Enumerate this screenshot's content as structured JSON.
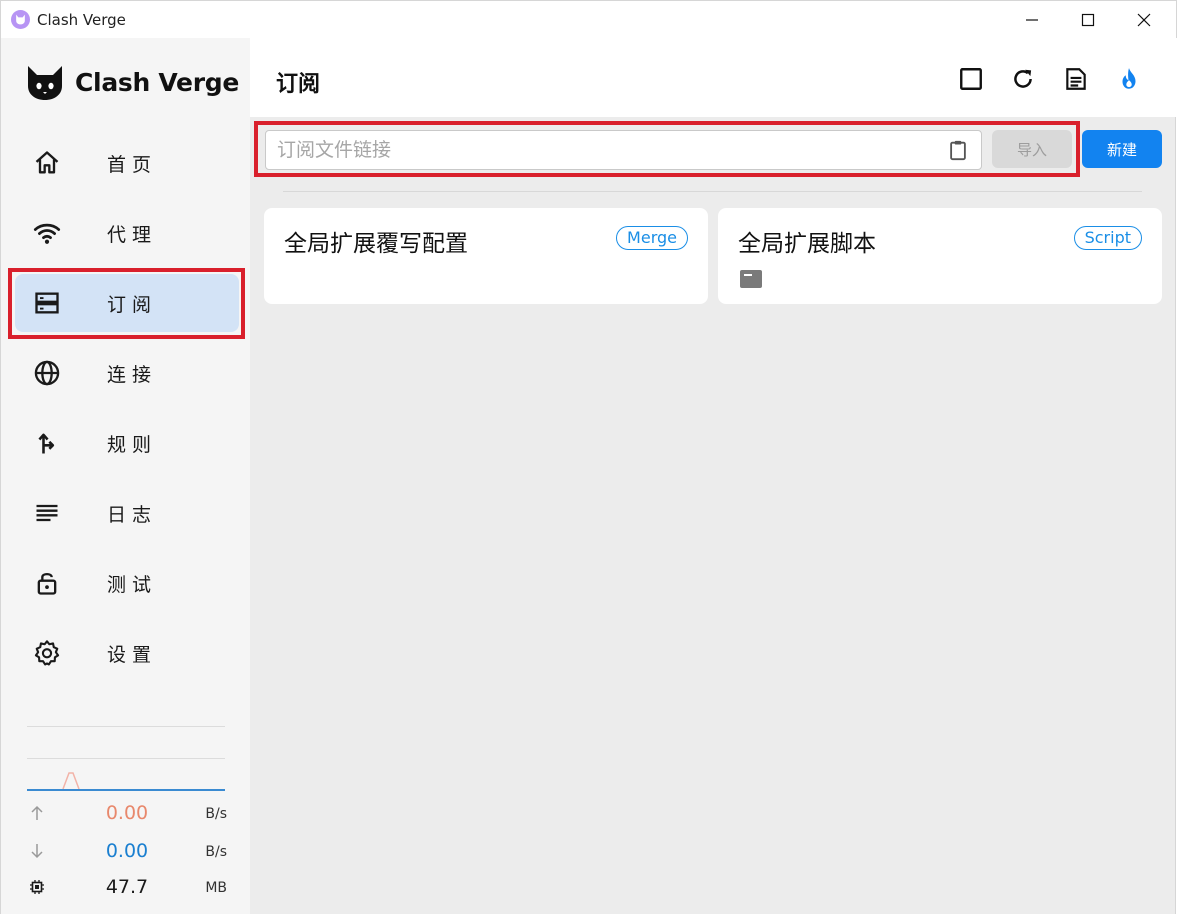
{
  "window": {
    "title": "Clash Verge"
  },
  "sidebar": {
    "logo_text": "Clash Verge",
    "items": [
      {
        "label": "首页",
        "icon": "home-icon",
        "active": false
      },
      {
        "label": "代理",
        "icon": "wifi-icon",
        "active": false
      },
      {
        "label": "订阅",
        "icon": "storage-icon",
        "active": true
      },
      {
        "label": "连接",
        "icon": "globe-icon",
        "active": false
      },
      {
        "label": "规则",
        "icon": "fork-arrow-icon",
        "active": false
      },
      {
        "label": "日志",
        "icon": "lines-icon",
        "active": false
      },
      {
        "label": "测试",
        "icon": "lock-open-icon",
        "active": false
      },
      {
        "label": "设置",
        "icon": "gear-icon",
        "active": false
      }
    ],
    "traffic": {
      "upload": {
        "value": "0.00",
        "unit": "B/s",
        "color": "#e8886c"
      },
      "download": {
        "value": "0.00",
        "unit": "B/s",
        "color": "#1a7fd0"
      },
      "memory": {
        "value": "47.7",
        "unit": "MB",
        "color": "#1a1a1a"
      }
    }
  },
  "main": {
    "title": "订阅",
    "url_input": {
      "placeholder": "订阅文件链接",
      "value": ""
    },
    "import_label": "导入",
    "new_label": "新建",
    "cards": [
      {
        "title": "全局扩展覆写配置",
        "tag": "Merge"
      },
      {
        "title": "全局扩展脚本",
        "tag": "Script"
      }
    ]
  },
  "colors": {
    "accent": "#1283f0",
    "highlight": "#d9202c",
    "active_nav": "#d3e3f6"
  }
}
